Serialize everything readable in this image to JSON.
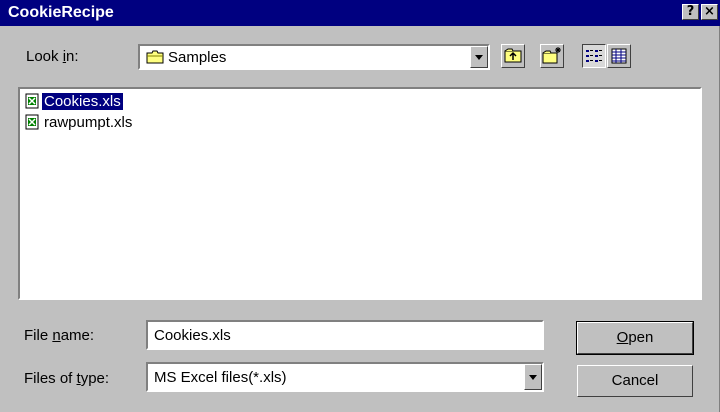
{
  "window": {
    "title": "CookieRecipe",
    "help_label": "?",
    "close_label": "×"
  },
  "look_in": {
    "label_pre": "Look ",
    "label_u": "i",
    "label_post": "n:",
    "value": "Samples"
  },
  "files": [
    {
      "name": "Cookies.xls",
      "selected": true
    },
    {
      "name": "rawpumpt.xls",
      "selected": false
    }
  ],
  "file_name": {
    "label_pre": "File ",
    "label_u": "n",
    "label_post": "ame:",
    "value": "Cookies.xls"
  },
  "files_of_type": {
    "label_pre": "Files of ",
    "label_u": "t",
    "label_post": "ype:",
    "value": "MS Excel files(*.xls)"
  },
  "buttons": {
    "open_u": "O",
    "open_rest": "pen",
    "cancel": "Cancel"
  },
  "colors": {
    "titlebar": "#000080",
    "face": "#c0c0c0",
    "selection": "#000080"
  }
}
